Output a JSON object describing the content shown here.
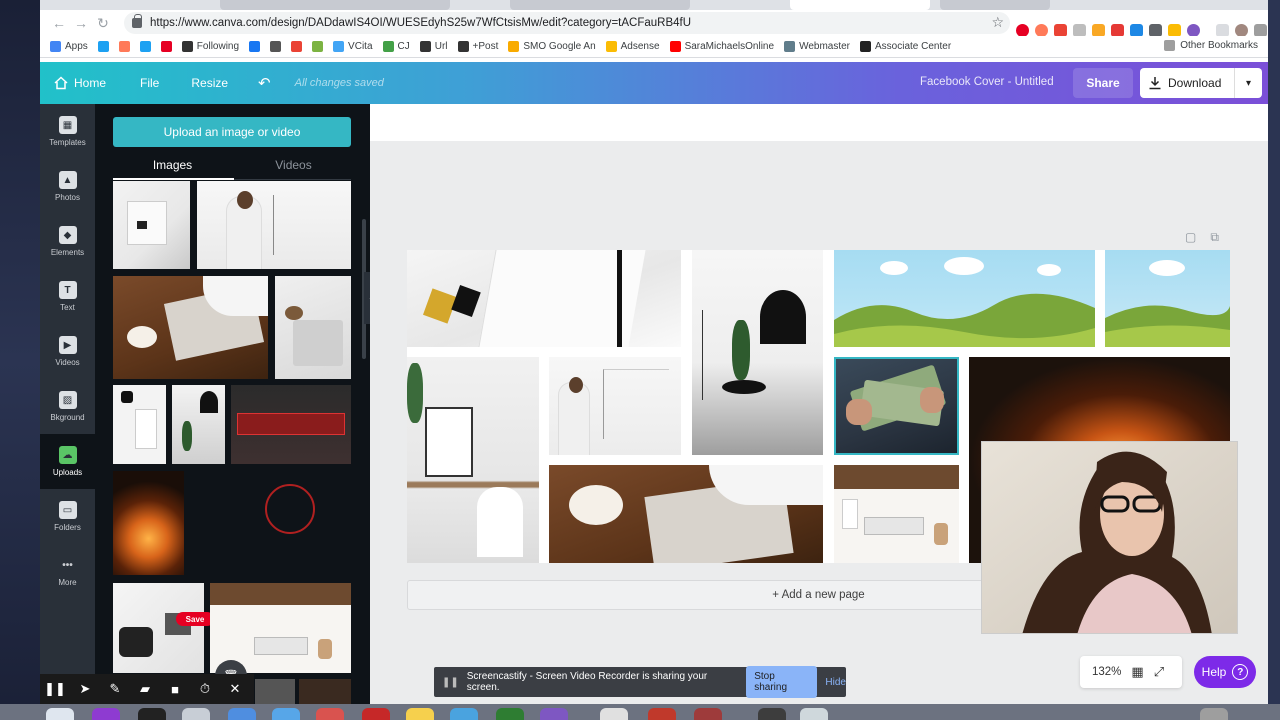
{
  "browser": {
    "url": "https://www.canva.com/design/DADdawIS4OI/WUESEdyhS25w7WfCtsisMw/edit?category=tACFauRB4fU",
    "bookmarks": [
      {
        "label": "Apps",
        "color": "#4285f4"
      },
      {
        "label": "",
        "color": "#1da1f2"
      },
      {
        "label": "",
        "color": "#ff7a59"
      },
      {
        "label": "",
        "color": "#1da1f2"
      },
      {
        "label": "",
        "color": "#e60023"
      },
      {
        "label": "Following",
        "color": "#333333"
      },
      {
        "label": "",
        "color": "#1877f2"
      },
      {
        "label": "",
        "color": "#555555"
      },
      {
        "label": "",
        "color": "#ea4335"
      },
      {
        "label": "",
        "color": "#7cb342"
      },
      {
        "label": "VCita",
        "color": "#42a5f5"
      },
      {
        "label": "CJ",
        "color": "#43a047"
      },
      {
        "label": "Url",
        "color": "#333333"
      },
      {
        "label": "+Post",
        "color": "#333333"
      },
      {
        "label": "SMO Google An",
        "color": "#f9ab00"
      },
      {
        "label": "Adsense",
        "color": "#fbbc04"
      },
      {
        "label": "SaraMichaelsOnline",
        "color": "#ff0000"
      },
      {
        "label": "Webmaster",
        "color": "#607d8b"
      },
      {
        "label": "Associate Center",
        "color": "#222222"
      }
    ],
    "other_bookmarks": "Other Bookmarks"
  },
  "header": {
    "home": "Home",
    "file": "File",
    "resize": "Resize",
    "saved_status": "All changes saved",
    "doc_title": "Facebook Cover - Untitled",
    "share": "Share",
    "download": "Download"
  },
  "rail": [
    {
      "label": "Templates",
      "icon": "templates-icon",
      "glyph": "▦",
      "active": false
    },
    {
      "label": "Photos",
      "icon": "photos-icon",
      "glyph": "▲",
      "active": false
    },
    {
      "label": "Elements",
      "icon": "elements-icon",
      "glyph": "◆",
      "active": false
    },
    {
      "label": "Text",
      "icon": "text-icon",
      "glyph": "T",
      "active": false
    },
    {
      "label": "Videos",
      "icon": "videos-icon",
      "glyph": "▶",
      "active": false
    },
    {
      "label": "Bkground",
      "icon": "background-icon",
      "glyph": "▨",
      "active": false
    },
    {
      "label": "Uploads",
      "icon": "uploads-icon",
      "glyph": "☁",
      "active": true
    },
    {
      "label": "Folders",
      "icon": "folders-icon",
      "glyph": "▭",
      "active": false
    },
    {
      "label": "More",
      "icon": "more-icon",
      "glyph": "•••",
      "active": false
    }
  ],
  "panel": {
    "upload_button": "Upload an image or video",
    "tab_images": "Images",
    "tab_videos": "Videos",
    "save_pin": "Save"
  },
  "canvas": {
    "add_page": "+ Add a new page"
  },
  "zoom": {
    "value": "132%"
  },
  "help": {
    "label": "Help",
    "glyph": "?"
  },
  "screencastify": {
    "message": "Screencastify - Screen Video Recorder is sharing your screen.",
    "stop": "Stop sharing",
    "hide": "Hide"
  },
  "colors": {
    "accent_teal": "#35b7c4",
    "help_purple": "#7d2ae8",
    "rail_bg": "#293039",
    "panel_bg": "#0e1318"
  }
}
